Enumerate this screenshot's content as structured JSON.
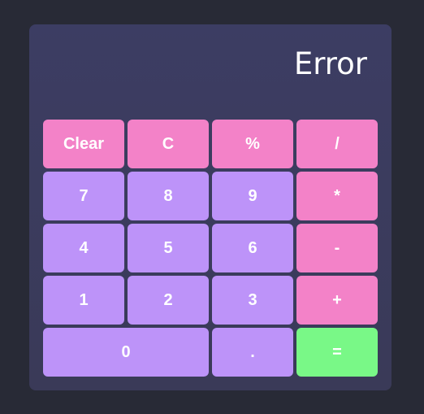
{
  "display": {
    "value": "Error"
  },
  "colors": {
    "background": "#282a36",
    "panel": "#3b3c5f",
    "function_key": "#f382c8",
    "number_key": "#bd93f9",
    "equals_key": "#79f887",
    "text": "#ffffff"
  },
  "keys": {
    "clear": "Clear",
    "c": "C",
    "percent": "%",
    "divide": "/",
    "seven": "7",
    "eight": "8",
    "nine": "9",
    "multiply": "*",
    "four": "4",
    "five": "5",
    "six": "6",
    "subtract": "-",
    "one": "1",
    "two": "2",
    "three": "3",
    "add": "+",
    "zero": "0",
    "decimal": ".",
    "equals": "="
  }
}
